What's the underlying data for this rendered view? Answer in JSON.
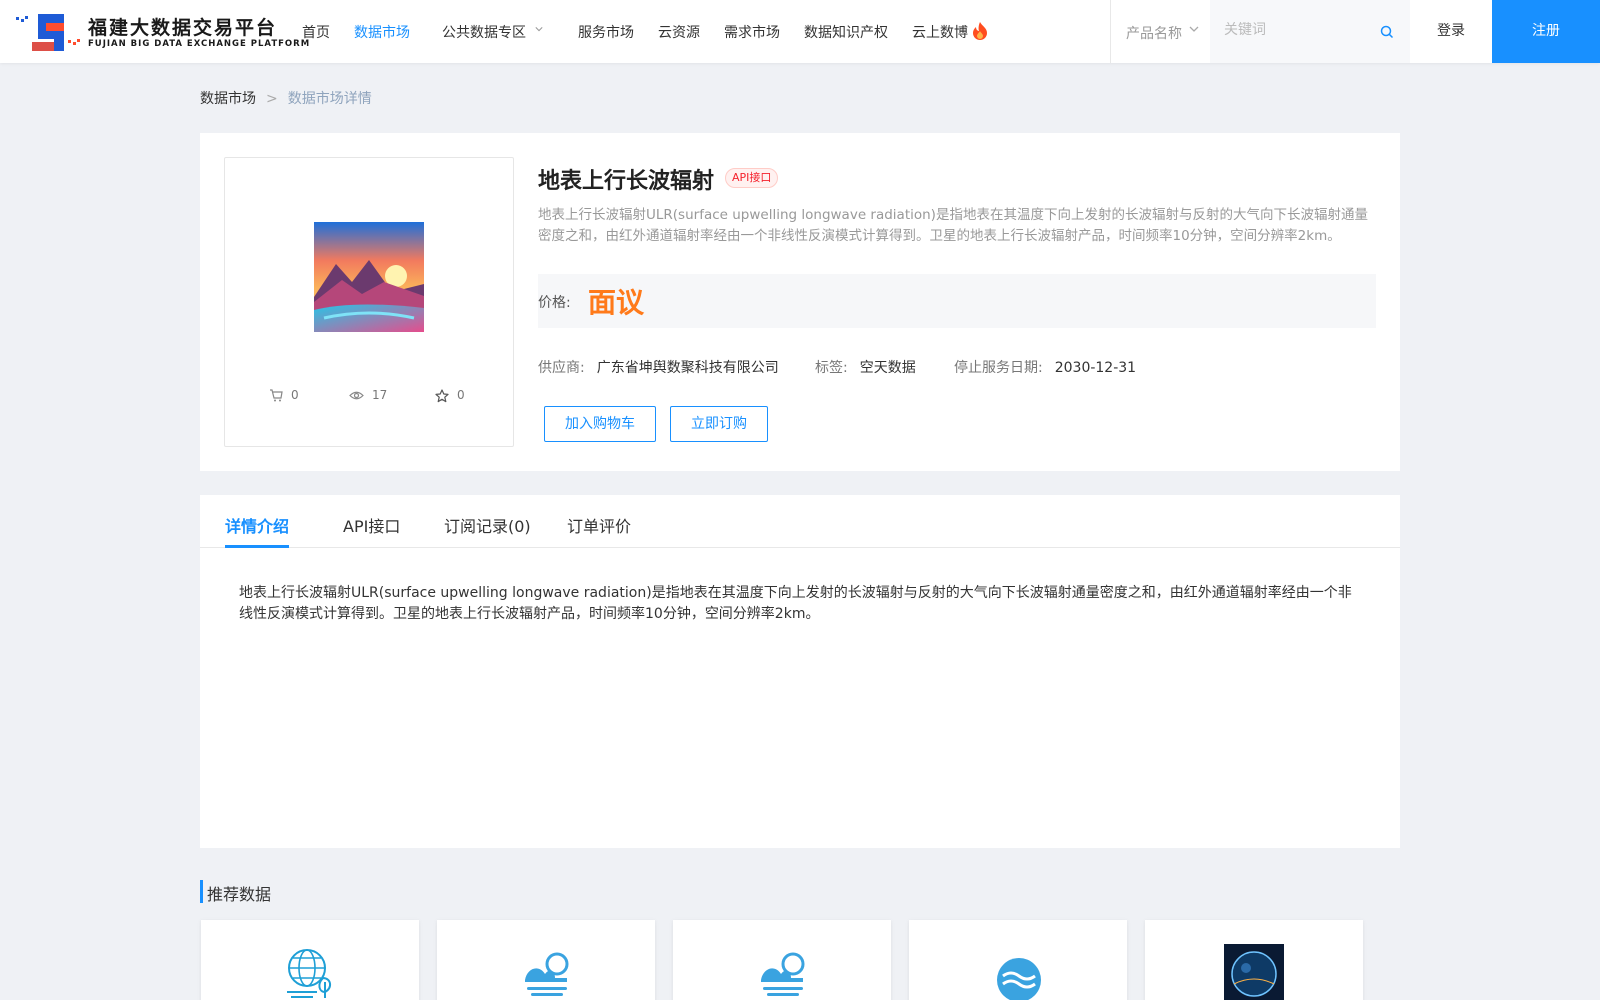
{
  "header": {
    "logo": {
      "cn": "福建大数据交易平台",
      "en": "FUJIAN BIG DATA EXCHANGE  PLATFORM"
    },
    "nav": [
      {
        "label": "首页",
        "active": false
      },
      {
        "label": "数据市场",
        "active": true
      },
      {
        "label": "公共数据专区",
        "active": false
      },
      {
        "label": "服务市场",
        "active": false
      },
      {
        "label": "云资源",
        "active": false
      },
      {
        "label": "需求市场",
        "active": false
      },
      {
        "label": "数据知识产权",
        "active": false
      },
      {
        "label": "云上数博",
        "active": false
      }
    ],
    "search": {
      "category": "产品名称",
      "placeholder": "关键词",
      "value": ""
    },
    "login": "登录",
    "register": "注册"
  },
  "breadcrumb": {
    "root": "数据市场",
    "separator": ">",
    "current": "数据市场详情"
  },
  "product": {
    "stats": {
      "cart": "0",
      "views": "17",
      "favorites": "0"
    },
    "title": "地表上行长波辐射",
    "tag": "API接口",
    "description": "地表上行长波辐射ULR(surface upwelling longwave radiation)是指地表在其温度下向上发射的长波辐射与反射的大气向下长波辐射通量密度之和，由红外通道辐射率经由一个非线性反演模式计算得到。卫星的地表上行长波辐射产品，时间频率10分钟，空间分辨率2km。",
    "price_label": "价格:",
    "price": "面议",
    "supplier_label": "供应商:",
    "supplier": "广东省坤舆数聚科技有限公司",
    "tag_label": "标签:",
    "tag_value": "空天数据",
    "stop_label": "停止服务日期:",
    "stop_date": "2030-12-31",
    "btn_cart": "加入购物车",
    "btn_order": "立即订购"
  },
  "detail": {
    "tabs": [
      "详情介绍",
      "API接口",
      "订阅记录(0)",
      "订单评价"
    ],
    "active_tab": 0,
    "text": "地表上行长波辐射ULR(surface upwelling longwave radiation)是指地表在其温度下向上发射的长波辐射与反射的大气向下长波辐射通量密度之和，由红外通道辐射率经由一个非线性反演模式计算得到。卫星的地表上行长波辐射产品，时间频率10分钟，空间分辨率2km。"
  },
  "recommend": {
    "title": "推荐数据",
    "items": [
      {
        "icon": "globe-leaf-icon"
      },
      {
        "icon": "cloud-sun-water-icon"
      },
      {
        "icon": "cloud-sun-water-icon"
      },
      {
        "icon": "water-waves-icon"
      },
      {
        "icon": "earth-photo-icon"
      }
    ]
  },
  "colors": {
    "accent": "#1890ff",
    "price": "#ff7a1a",
    "tag_red": "#f5222d"
  }
}
